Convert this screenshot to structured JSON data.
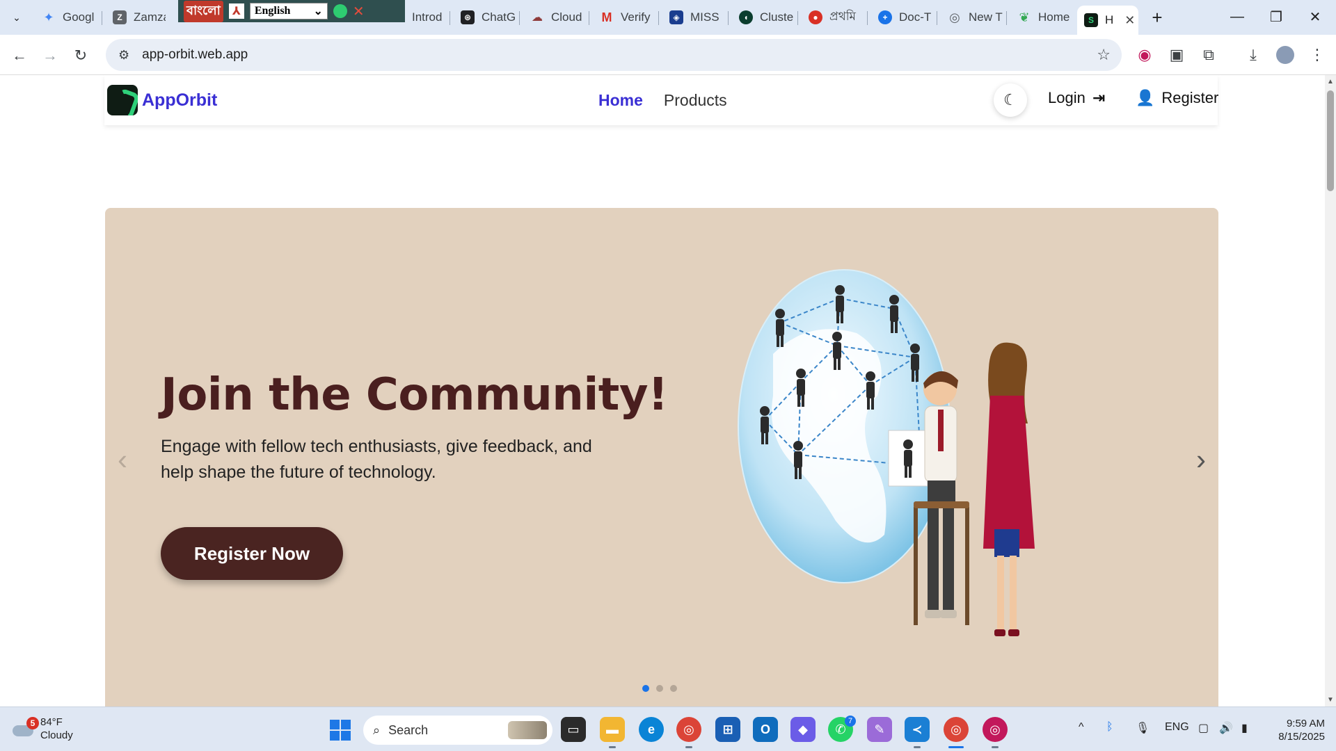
{
  "browser": {
    "tabs": [
      {
        "title": "Googl",
        "favicon": "gemini-icon",
        "color": "#4285f4"
      },
      {
        "title": "Zamza",
        "favicon": "zamzar-icon",
        "color": "#5f6368"
      },
      {
        "title": "Introd",
        "favicon": "page-icon",
        "color": "#5f6368"
      },
      {
        "title": "ChatG",
        "favicon": "openai-icon",
        "color": "#202124"
      },
      {
        "title": "Cloud",
        "favicon": "cloud-icon",
        "color": "#8f3b3b"
      },
      {
        "title": "Verify",
        "favicon": "gmail-icon",
        "color": "#d93025"
      },
      {
        "title": "MISS",
        "favicon": "shield-icon",
        "color": "#1a3d8f"
      },
      {
        "title": "Cluste",
        "favicon": "mongodb-icon",
        "color": "#0b3d2e"
      },
      {
        "title": "প্রথমি",
        "favicon": "news-icon",
        "color": "#d93025"
      },
      {
        "title": "Doc-T",
        "favicon": "plus-icon",
        "color": "#1a73e8"
      },
      {
        "title": "New T",
        "favicon": "chrome-icon",
        "color": "#5f6368"
      },
      {
        "title": "Home",
        "favicon": "leaf-icon",
        "color": "#34a853"
      },
      {
        "title": "H",
        "favicon": "apporbit-icon",
        "color": "#0f1c14"
      }
    ],
    "overlay": {
      "bangla_label": "বাংলো",
      "language": "English"
    },
    "url": "app-orbit.web.app"
  },
  "site": {
    "brand": "AppOrbit",
    "nav": {
      "home": "Home",
      "products": "Products",
      "login": "Login",
      "register": "Register"
    },
    "hero": {
      "title": "Join the Community!",
      "description": "Engage with fellow tech enthusiasts, give feedback, and help shape the future of technology.",
      "cta": "Register Now",
      "slides": 3,
      "active_slide": 1
    }
  },
  "taskbar": {
    "weather": {
      "temp": "84°F",
      "condition": "Cloudy",
      "badge": "5"
    },
    "search_placeholder": "Search",
    "whatsapp_badge": "7",
    "language": "ENG",
    "time": "9:59 AM",
    "date": "8/15/2025"
  }
}
